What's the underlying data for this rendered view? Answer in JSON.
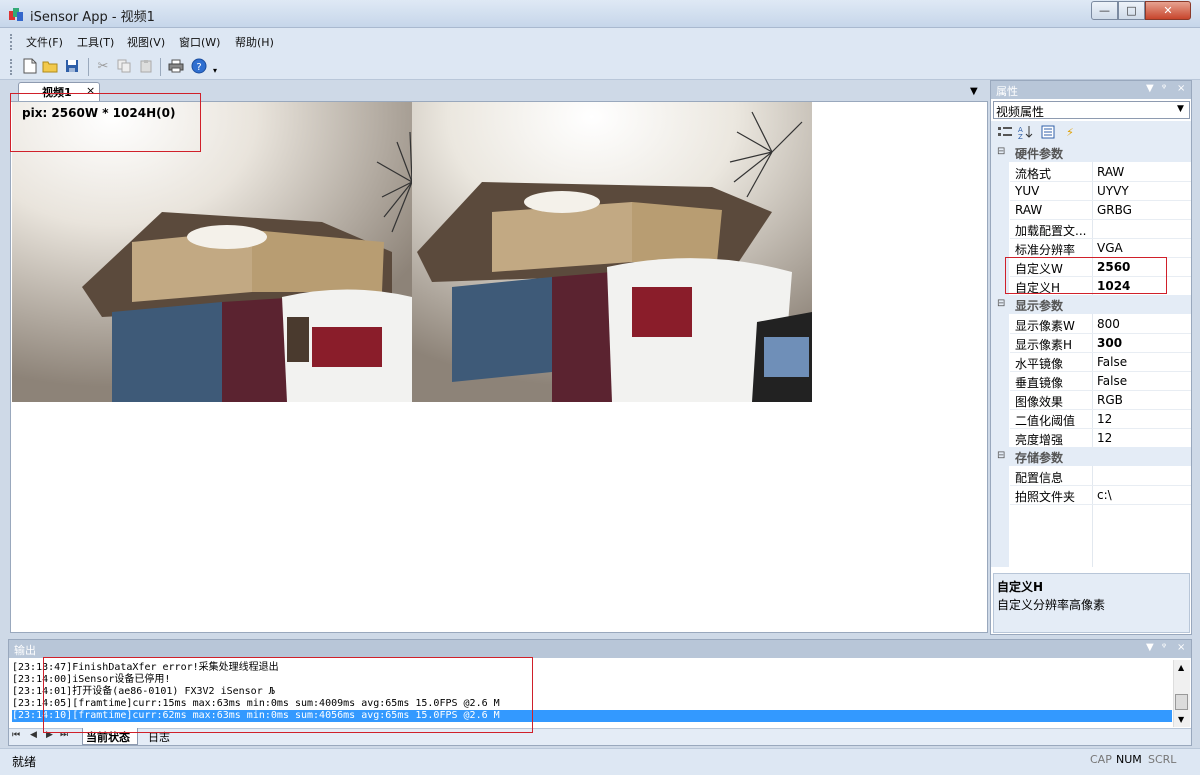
{
  "window": {
    "title": "iSensor App - 视频1",
    "controls": {
      "minimize": "—",
      "maximize": "□",
      "close": "✕"
    }
  },
  "menu": {
    "file": "文件(F)",
    "tools": "工具(T)",
    "view": "视图(V)",
    "window": "窗口(W)",
    "help": "帮助(H)"
  },
  "toolbar": {
    "icons": [
      "new-icon",
      "open-icon",
      "save-icon",
      "cut-icon",
      "copy-icon",
      "paste-icon",
      "print-icon",
      "help-icon"
    ]
  },
  "document": {
    "tab_label": "视频1",
    "tab_close": "×",
    "dropdown": "▼",
    "pix_label": "pix: 2560W * 1024H(0)"
  },
  "properties": {
    "title": "属性",
    "header_buttons": {
      "dropdown": "▼",
      "pin": "ᵠ",
      "close": "×"
    },
    "object_select": "视频属性",
    "toolbar_icons": [
      "categorized-icon",
      "alphabetical-icon",
      "property-pages-icon",
      "events-icon"
    ],
    "categories": [
      {
        "label": "硬件参数",
        "toggle": "⊟",
        "rows": [
          {
            "name": "流格式",
            "value": "RAW",
            "bold": false
          },
          {
            "name": "YUV",
            "value": "UYVY",
            "bold": false
          },
          {
            "name": "RAW",
            "value": "GRBG",
            "bold": false
          },
          {
            "name": "加载配置文...",
            "value": "",
            "bold": false
          },
          {
            "name": "标准分辨率",
            "value": "VGA",
            "bold": false
          },
          {
            "name": "自定义W",
            "value": "2560",
            "bold": true
          },
          {
            "name": "自定义H",
            "value": "1024",
            "bold": true
          }
        ]
      },
      {
        "label": "显示参数",
        "toggle": "⊟",
        "rows": [
          {
            "name": "显示像素W",
            "value": "800",
            "bold": false
          },
          {
            "name": "显示像素H",
            "value": "300",
            "bold": true
          },
          {
            "name": "水平镜像",
            "value": "False",
            "bold": false
          },
          {
            "name": "垂直镜像",
            "value": "False",
            "bold": false
          },
          {
            "name": "图像效果",
            "value": "RGB",
            "bold": false
          },
          {
            "name": "二值化阈值",
            "value": "12",
            "bold": false
          },
          {
            "name": "亮度增强",
            "value": "12",
            "bold": false
          }
        ]
      },
      {
        "label": "存储参数",
        "toggle": "⊟",
        "rows": [
          {
            "name": "配置信息",
            "value": "",
            "bold": false
          },
          {
            "name": "拍照文件夹",
            "value": "c:\\",
            "bold": false
          }
        ]
      }
    ],
    "description": {
      "title": "自定义H",
      "text": "自定义分辨率高像素"
    }
  },
  "output": {
    "title": "输出",
    "header_buttons": {
      "dropdown": "▼",
      "pin": "ᵠ",
      "close": "×"
    },
    "lines": [
      {
        "text": "[23:13:47]FinishDataXfer error!采集处理线程退出",
        "selected": false
      },
      {
        "text": "[23:14:00]iSensor设备已停用!",
        "selected": false
      },
      {
        "text": "[23:14:01]打开设备(ae86-0101) FX3V2 iSensor Љ",
        "selected": false
      },
      {
        "text": "[23:14:05][framtime]curr:15ms max:63ms min:0ms sum:4009ms avg:65ms 15.0FPS @2.6 M",
        "selected": false
      },
      {
        "text": "[23:14:10][framtime]curr:62ms max:63ms min:0ms sum:4056ms avg:65ms 15.0FPS @2.6 M",
        "selected": true
      }
    ],
    "nav": {
      "first": "⏮",
      "prev": "◀",
      "next": "▶",
      "last": "⏭"
    },
    "tabs": {
      "current": "当前状态",
      "log": "日志"
    }
  },
  "statusbar": {
    "text": "就绪",
    "indicators": {
      "cap": "CAP",
      "num": "NUM",
      "scrl": "SCRL"
    }
  },
  "colors": {
    "window_bg": "#ced9e7",
    "panel_header": "#b8c6d8",
    "selection": "#3399ff",
    "highlight_box": "#d0202a"
  }
}
